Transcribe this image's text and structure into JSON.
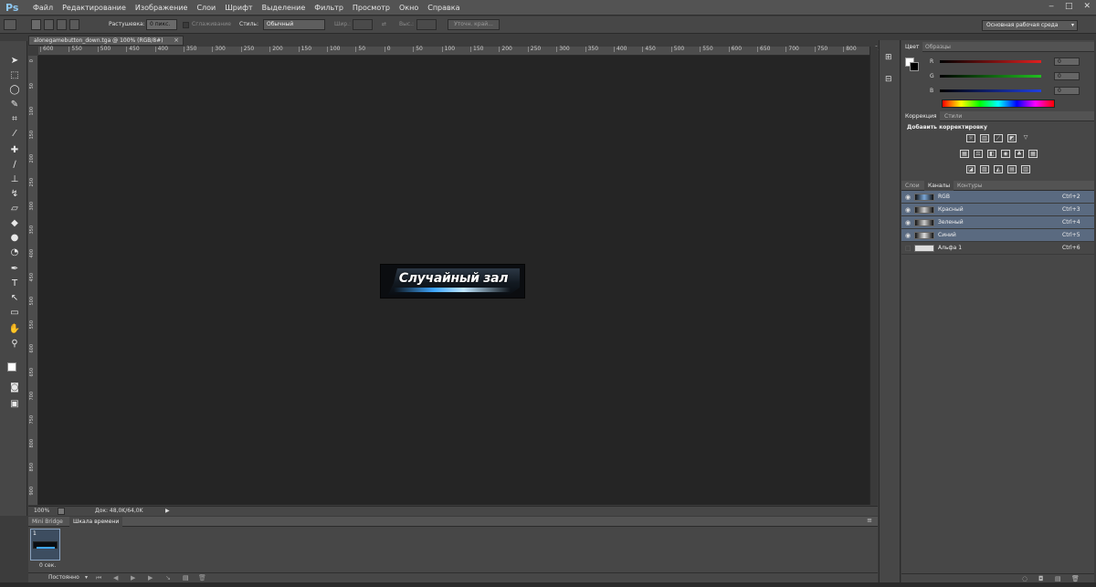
{
  "app": {
    "logo": "Ps"
  },
  "menu": [
    "Файл",
    "Редактирование",
    "Изображение",
    "Слои",
    "Шрифт",
    "Выделение",
    "Фильтр",
    "Просмотр",
    "Окно",
    "Справка"
  ],
  "window_buttons": [
    "‒",
    "□",
    "✕"
  ],
  "options": {
    "feather_label": "Растушевка:",
    "feather_value": "0 пикс.",
    "antialias_label": "Сглаживание",
    "style_label": "Стиль:",
    "style_value": "Обычный",
    "width_label": "Шир.:",
    "height_label": "Выс.:",
    "refine_edge": "Уточн. край..."
  },
  "workspace": "Основная рабочая среда",
  "document": {
    "tab_title": "alonegamebutton_down.tga @ 100% (RGB/8#)",
    "tab_close": "×",
    "button_text": "Случайный зал"
  },
  "ruler_h": [
    "600",
    "550",
    "500",
    "450",
    "400",
    "350",
    "300",
    "250",
    "200",
    "150",
    "100",
    "50",
    "0",
    "50",
    "100",
    "150",
    "200",
    "250",
    "300",
    "350",
    "400",
    "450",
    "500",
    "550",
    "600",
    "650",
    "700",
    "750",
    "800",
    "850"
  ],
  "ruler_v": [
    "0",
    "50",
    "100",
    "150",
    "200",
    "250",
    "300",
    "350",
    "400",
    "450",
    "500",
    "550",
    "600",
    "650",
    "700",
    "750",
    "800",
    "850",
    "900"
  ],
  "status": {
    "zoom": "100%",
    "doc": "Док: 48,0K/64,0K"
  },
  "timeline": {
    "tabs": [
      "Mini Bridge",
      "Шкала времени"
    ],
    "frame_number": "1",
    "frame_delay": "0 сек.",
    "loop": "Постоянно"
  },
  "color_panel": {
    "tabs": [
      "Цвет",
      "Образцы"
    ],
    "channels": [
      {
        "label": "R",
        "value": "0",
        "color": "#e02020"
      },
      {
        "label": "G",
        "value": "0",
        "color": "#20c020"
      },
      {
        "label": "B",
        "value": "0",
        "color": "#2040e0"
      }
    ]
  },
  "adjust_panel": {
    "tabs": [
      "Коррекция",
      "Стили"
    ],
    "heading": "Добавить корректировку"
  },
  "channels_panel": {
    "tabs": [
      "Слои",
      "Каналы",
      "Контуры"
    ],
    "rows": [
      {
        "name": "RGB",
        "key": "Ctrl+2",
        "selected": true
      },
      {
        "name": "Красный",
        "key": "Ctrl+3",
        "selected": true
      },
      {
        "name": "Зеленый",
        "key": "Ctrl+4",
        "selected": true
      },
      {
        "name": "Синий",
        "key": "Ctrl+5",
        "selected": true
      },
      {
        "name": "Альфа 1",
        "key": "Ctrl+6",
        "selected": false
      }
    ]
  }
}
